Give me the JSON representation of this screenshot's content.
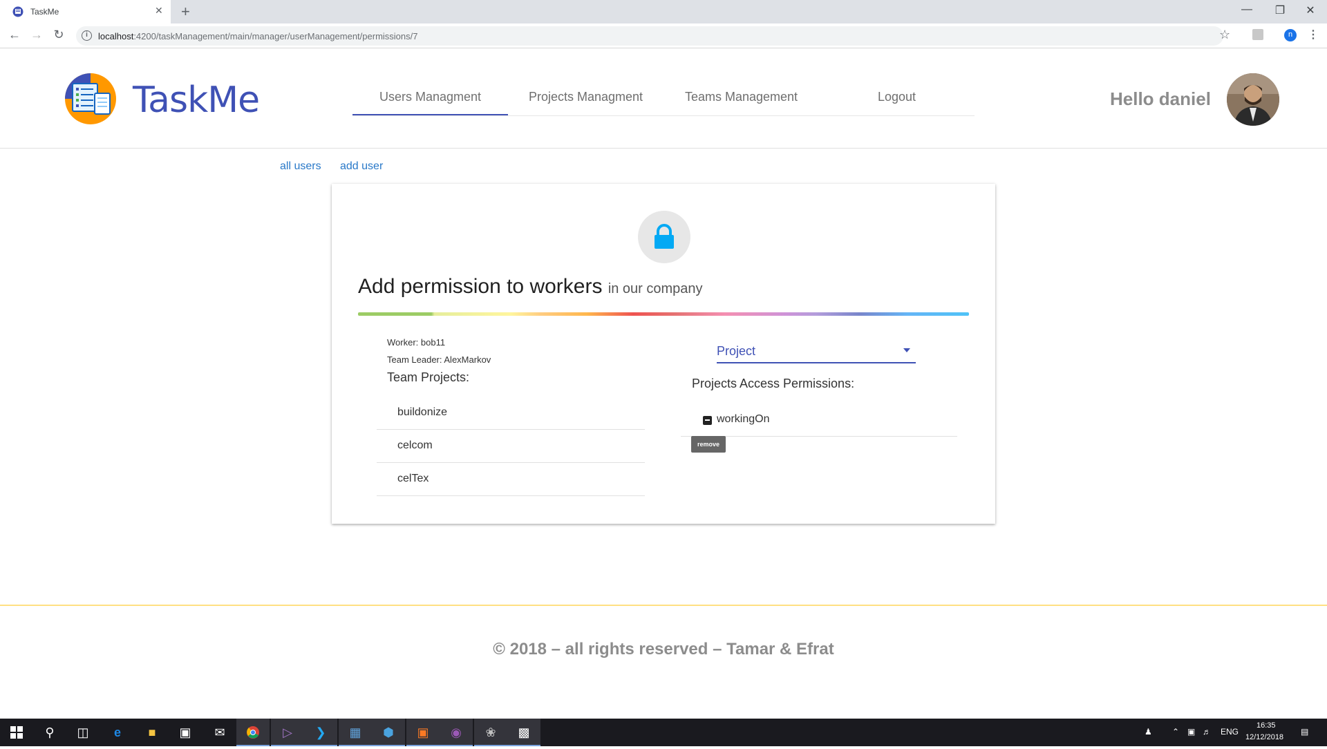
{
  "browser": {
    "tab_title": "TaskMe",
    "url_host": "localhost",
    "url_rest": ":4200/taskManagement/main/manager/userManagement/permissions/7",
    "new_tab_symbol": "+",
    "close_symbol": "✕",
    "profile_initial": "n"
  },
  "header": {
    "app_title": "TaskMe",
    "nav": [
      {
        "label": "Users Managment",
        "active": true
      },
      {
        "label": "Projects Managment",
        "active": false
      },
      {
        "label": "Teams Management",
        "active": false
      },
      {
        "label": "Logout",
        "active": false
      }
    ],
    "greeting": "Hello daniel"
  },
  "subnav": {
    "all_users": "all users",
    "add_user": "add user"
  },
  "card": {
    "title": "Add permission to workers",
    "subtitle": "in our company",
    "worker": "Worker: bob11",
    "team_leader": "Team Leader: AlexMarkov",
    "team_projects_label": "Team Projects:",
    "projects": [
      "buildonize",
      "celcom",
      "celTex"
    ],
    "select_value": "Project",
    "access_label": "Projects Access Permissions:",
    "permission": "workingOn",
    "remove_tooltip": "remove",
    "accent_color": "#3f51b5",
    "lock_color": "#03a9f4"
  },
  "footer": {
    "text": "© 2018 – all rights reserved – Tamar & Efrat"
  },
  "taskbar": {
    "language": "ENG",
    "time": "16:35",
    "date": "12/12/2018"
  }
}
